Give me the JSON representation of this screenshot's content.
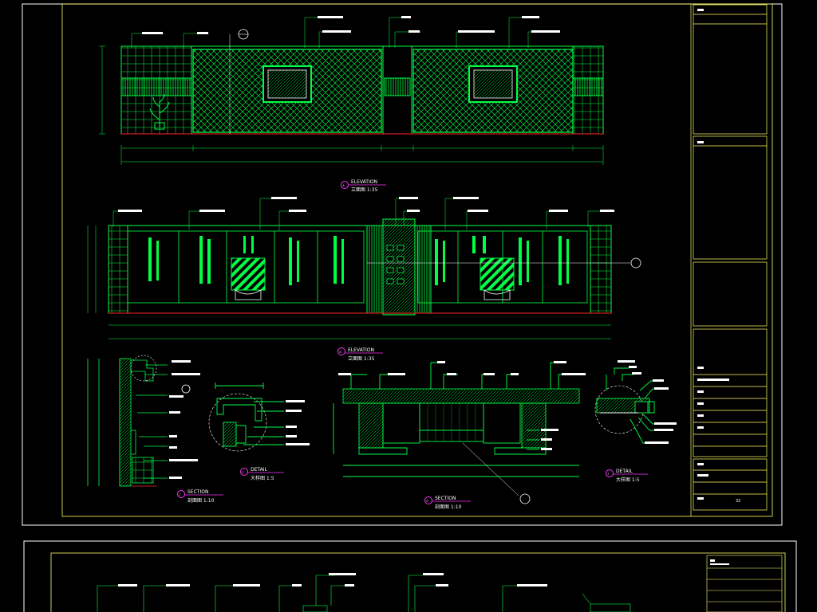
{
  "sheet": {
    "elevation1_tag": {
      "code": "A",
      "title": "ELEVATION",
      "sub": "立面图 1:35"
    },
    "elevation2_tag": {
      "code": "B",
      "title": "ELEVATION",
      "sub": "立面图 1:35"
    },
    "section_c_tag": {
      "code": "C",
      "title": "SECTION",
      "sub": "剖面图 1:10"
    },
    "detail_e_tag": {
      "code": "E",
      "title": "DETAIL",
      "sub": "大样图 1:5"
    },
    "section_d_tag": {
      "code": "D",
      "title": "SECTION",
      "sub": "剖面图 1:10"
    },
    "detail_f_tag": {
      "code": "F",
      "title": "DETAIL",
      "sub": "大样图 1:5"
    },
    "sheet_number": "32"
  },
  "colors": {
    "line": "#00ff44",
    "frame": "#ffff66",
    "magenta": "#ff33ff",
    "red": "#ff2222",
    "cyan": "#66ffff",
    "white": "#ffffff"
  }
}
